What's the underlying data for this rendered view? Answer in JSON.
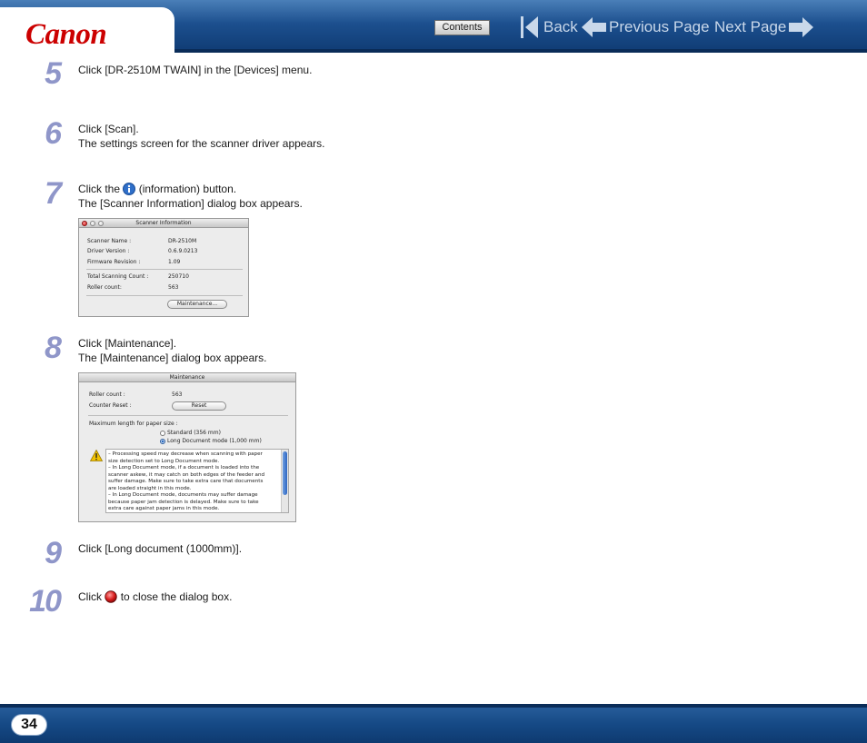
{
  "header": {
    "logo_text": "Canon",
    "contents_label": "Contents",
    "back_label": "Back",
    "prev_label": "Previous Page",
    "next_label": "Next Page"
  },
  "steps": [
    {
      "num": "5",
      "lines": [
        "Click [DR-2510M TWAIN] in the [Devices] menu."
      ]
    },
    {
      "num": "6",
      "lines": [
        "Click [Scan].",
        "The settings screen for the scanner driver appears."
      ]
    },
    {
      "num": "7",
      "line1_before": "Click the",
      "line1_after": "(information) button.",
      "line2": "The [Scanner Information] dialog box appears."
    },
    {
      "num": "8",
      "lines": [
        "Click [Maintenance].",
        "The [Maintenance] dialog box appears."
      ]
    },
    {
      "num": "9",
      "lines": [
        "Click [Long document (1000mm)]."
      ]
    },
    {
      "num": "10",
      "line_before": "Click",
      "line_after": "to close the dialog box."
    }
  ],
  "scanner_info_dialog": {
    "title": "Scanner Information",
    "rows": [
      {
        "label": "Scanner Name :",
        "value": "DR-2510M"
      },
      {
        "label": "Driver Version :",
        "value": "0.6.9.0213"
      },
      {
        "label": "Firmware Revision :",
        "value": "1.09"
      },
      {
        "label": "Total Scanning Count :",
        "value": "250710"
      },
      {
        "label": "Roller count:",
        "value": "563"
      }
    ],
    "maintenance_button": "Maintenance..."
  },
  "maintenance_dialog": {
    "title": "Maintenance",
    "roller_label": "Roller count :",
    "roller_value": "563",
    "counter_reset_label": "Counter Reset :",
    "reset_button": "Reset",
    "max_length_label": "Maximum length for paper size :",
    "options": [
      {
        "label": "Standard (356 mm)",
        "selected": false
      },
      {
        "label": "Long Document mode (1,000 mm)",
        "selected": true
      }
    ],
    "warning_lines": [
      "– Processing speed may decrease when scanning with paper",
      "size detection set to Long Document mode.",
      "– In Long Document mode, if a document is loaded into the",
      "scanner askew, it may catch on both edges of the feeder and",
      "suffer damage. Make sure to take extra care that documents",
      "are loaded straight in this mode.",
      "– In Long Document mode, documents may suffer damage",
      "because paper jam detection is delayed. Make sure to take",
      "extra care against paper jams in this mode."
    ]
  },
  "footer": {
    "page_number": "34"
  },
  "colors": {
    "header_blue": "#1c4f8e",
    "step_number": "#8f96c9",
    "logo_red": "#cc0000"
  },
  "icons": [
    "info-icon",
    "close-button-icon",
    "warning-icon",
    "back-arrow-icon",
    "previous-arrow-icon",
    "next-arrow-icon"
  ]
}
